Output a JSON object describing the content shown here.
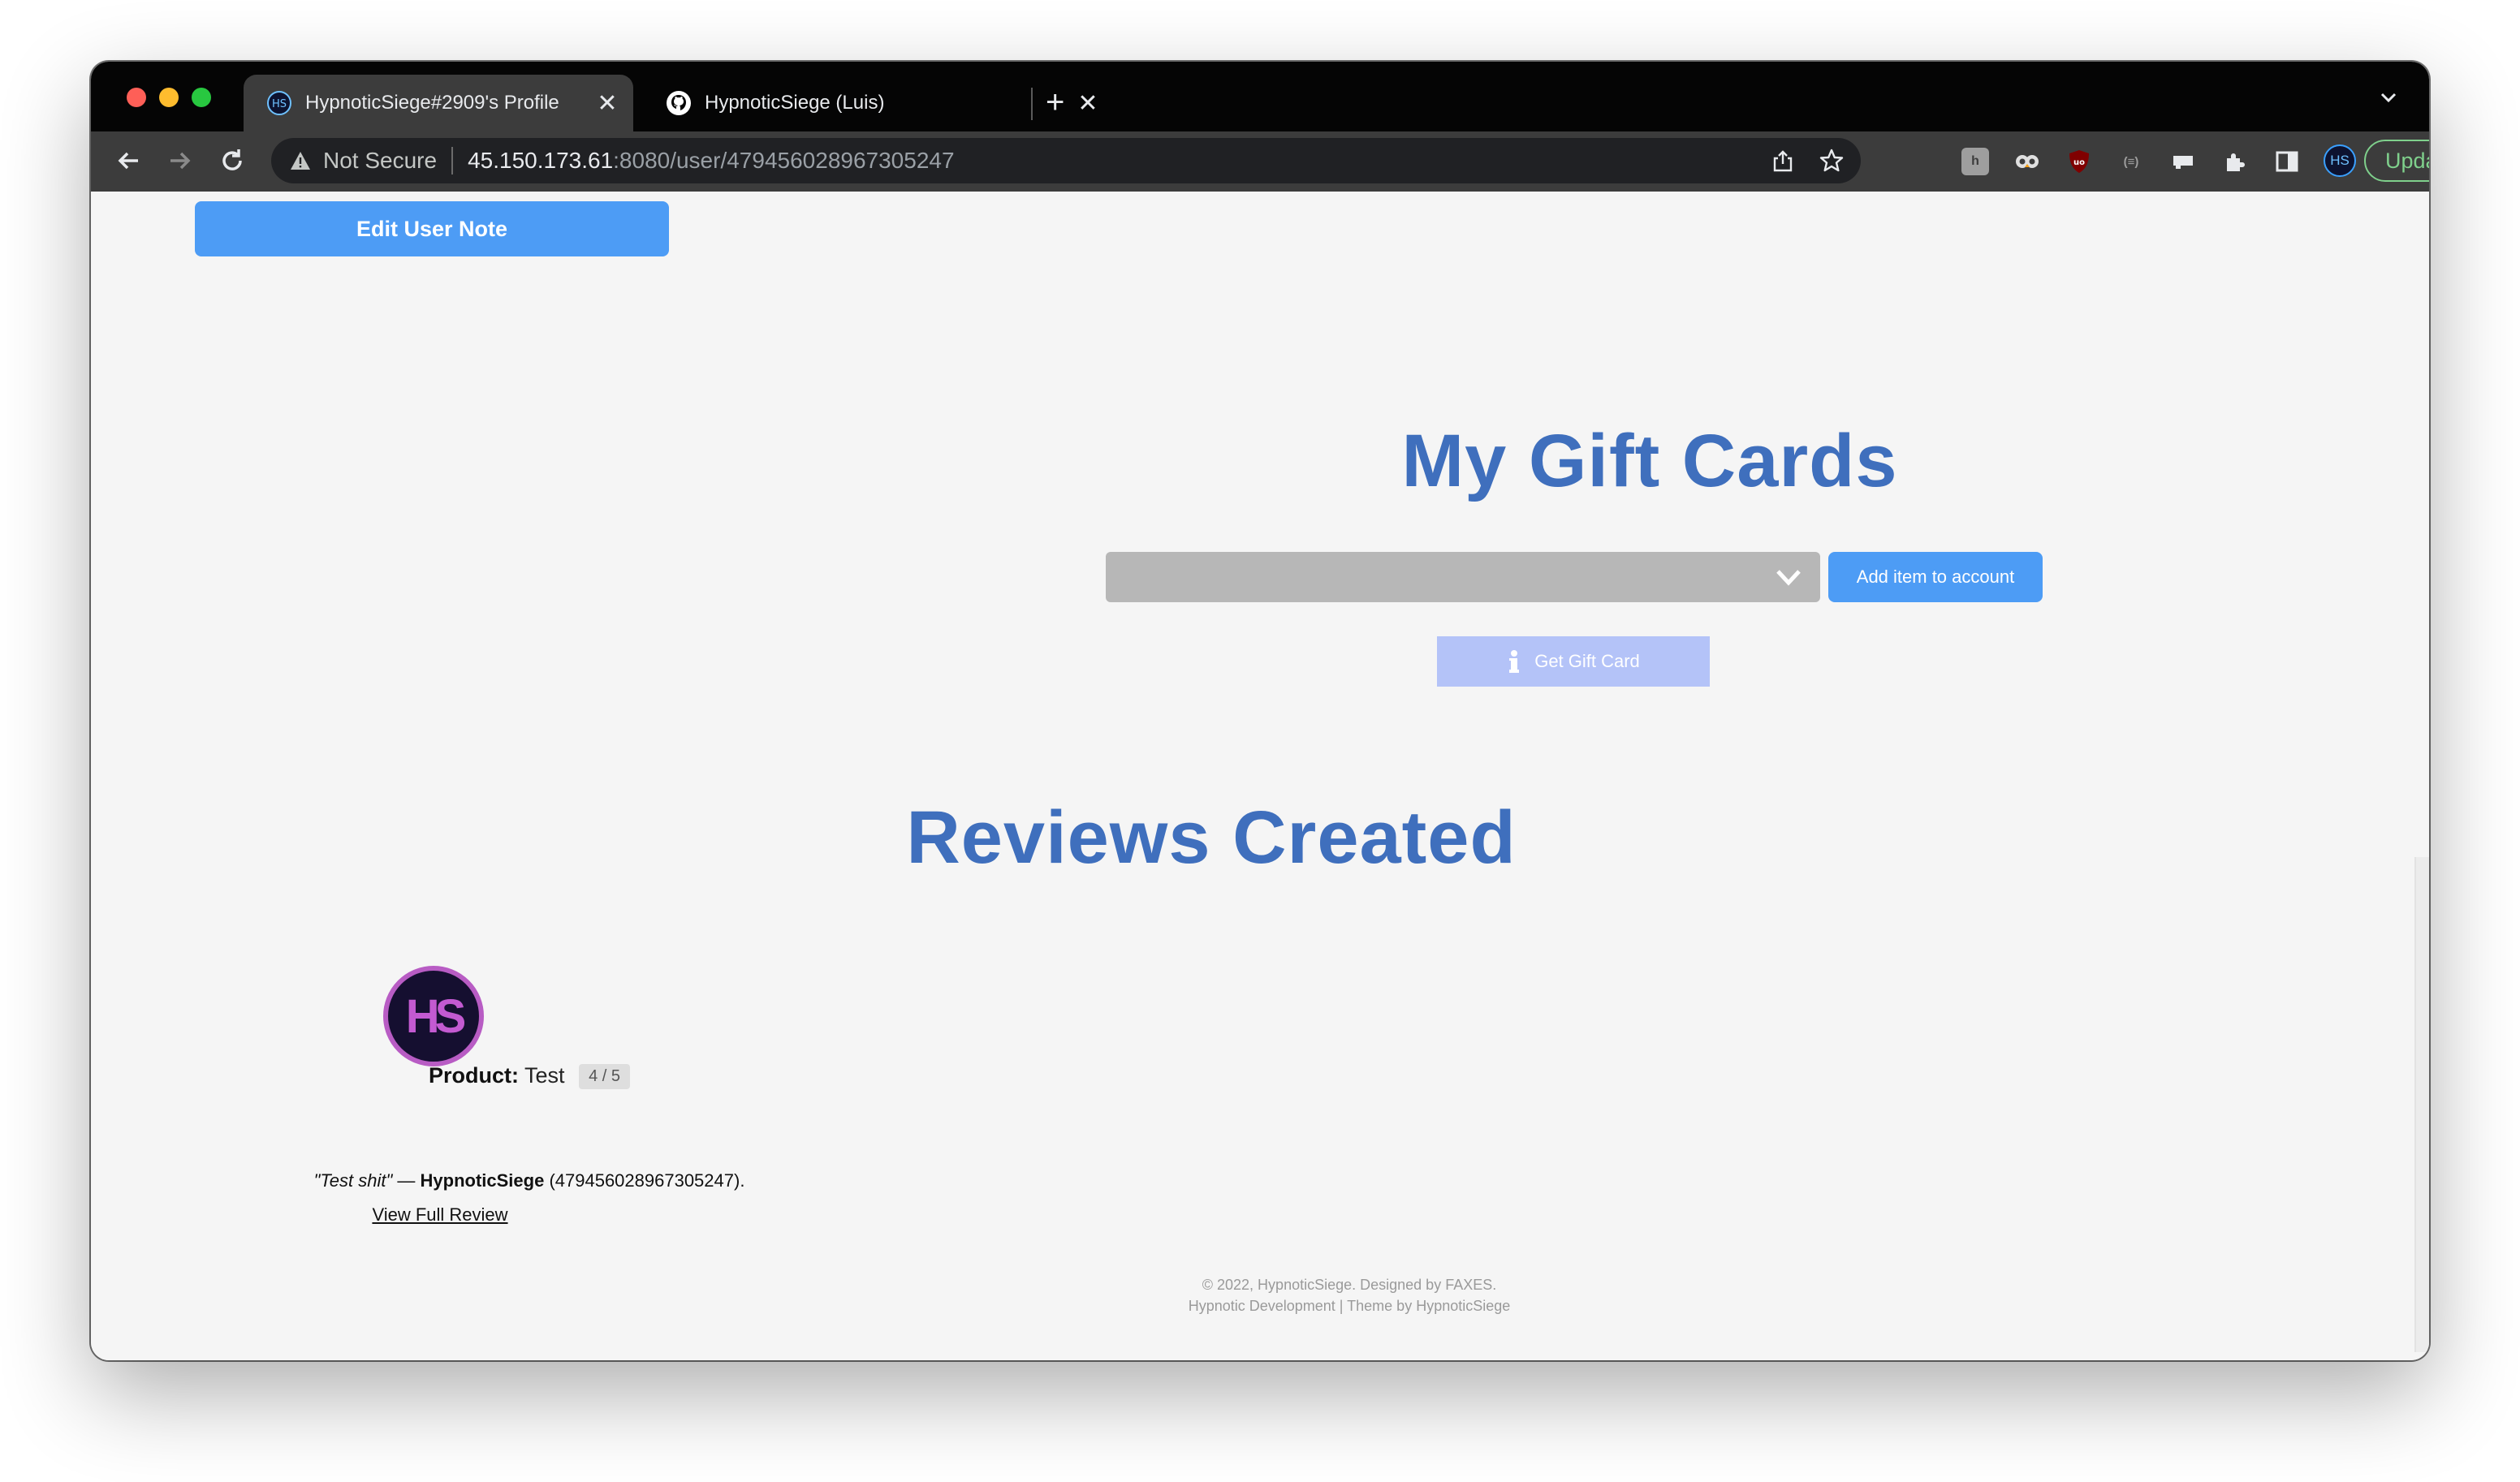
{
  "browser": {
    "tabs": [
      {
        "title": "HypnoticSiege#2909's Profile",
        "close": "✕",
        "favicon": "hypnoticsiege-icon"
      },
      {
        "title": "HypnoticSiege (Luis)",
        "close": "✕",
        "favicon": "github-icon"
      }
    ],
    "new_tab": "+",
    "address": {
      "security_label": "Not Secure",
      "host": "45.150.173.61",
      "rest": ":8080/user/479456028967305247"
    },
    "profile_initials": "HS",
    "update_label": "Update",
    "update_menu": "⋮"
  },
  "page": {
    "edit_note_label": "Edit User Note",
    "gift_cards": {
      "title": "My Gift Cards",
      "select_value": "",
      "add_item_label": "Add item to account",
      "get_gift_card_label": "Get Gift Card"
    },
    "reviews": {
      "title": "Reviews Created",
      "items": [
        {
          "avatar_text": "HS",
          "product_label": "Product:",
          "product_name": "Test",
          "rating": "4 / 5",
          "quote": "\"Test shit\"",
          "dash": " — ",
          "author": "HypnoticSiege",
          "author_id": " (479456028967305247).",
          "view_link": "View Full Review"
        }
      ]
    },
    "footer": {
      "line1": "© 2022, HypnoticSiege. Designed by FAXES.",
      "line2": "Hypnotic Development | Theme by HypnoticSiege"
    }
  },
  "colors": {
    "accent_blue": "#4d9cf5",
    "heading_blue": "#3f6fbd",
    "disabled_button": "#b4c3f8",
    "update_green": "#7fd08c"
  }
}
